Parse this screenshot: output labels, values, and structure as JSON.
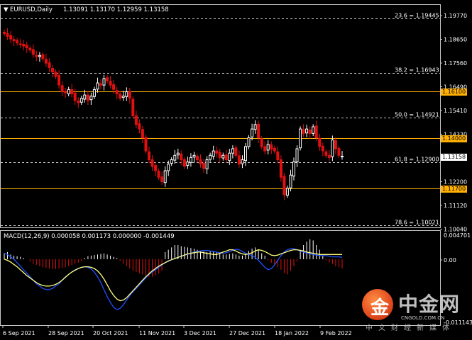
{
  "header": {
    "symbol": "EURUSD,Daily",
    "ohlc": "1.13091 1.13170 1.12959 1.13158",
    "macd_label": "MACD(12,26,9) 0.000058 0.001173 0.000000 -0.001449"
  },
  "fib_labels": [
    {
      "text": "23.6 = 1.19445",
      "price": 1.19445
    },
    {
      "text": "38.2 = 1.16943",
      "price": 1.16943
    },
    {
      "text": "50.0 = 1.14921",
      "price": 1.14921
    },
    {
      "text": "61.8 = 1.12900",
      "price": 1.129
    },
    {
      "text": "78.6 = 1.10021",
      "price": 1.10021
    }
  ],
  "level_lines": [
    {
      "label": "1.16100",
      "price": 1.161
    },
    {
      "label": "1.14000",
      "price": 1.14
    },
    {
      "label": "1.11700",
      "price": 1.117
    }
  ],
  "current_price": {
    "label": "1.13158",
    "price": 1.13158
  },
  "price_axis": [
    "1.19770",
    "1.18650",
    "1.17560",
    "1.16490",
    "1.15410",
    "1.14330",
    "1.13250",
    "1.12200",
    "1.11120",
    "1.10040"
  ],
  "macd_axis": [
    "0.004701",
    "0.00",
    "-0.011143"
  ],
  "date_axis": [
    "6 Sep 2021",
    "28 Sep 2021",
    "20 Oct 2021",
    "11 Nov 2021",
    "3 Dec 2021",
    "27 Dec 2021",
    "18 Jan 2022",
    "9 Feb 2022"
  ],
  "logo": {
    "cn": "中金网",
    "domain": "CNGOLD.COM.CN",
    "sub": "中文财经新媒体",
    "mark": "金"
  },
  "colors": {
    "up": "#ffffff",
    "down": "#e01010",
    "level": "#ffb000",
    "macd_signal": "#ffff80",
    "macd_line": "#2050ff",
    "grid": "#c8c8c8"
  },
  "chart_data": {
    "type": "candlestick",
    "price_range": [
      1.0995,
      1.2002
    ],
    "macd_range": [
      -0.011143,
      0.004701
    ],
    "closes": [
      1.1875,
      1.1862,
      1.185,
      1.1842,
      1.1832,
      1.1826,
      1.1818,
      1.181,
      1.18,
      1.178,
      1.177,
      1.1775,
      1.176,
      1.174,
      1.172,
      1.17,
      1.168,
      1.164,
      1.161,
      1.1605,
      1.162,
      1.16,
      1.157,
      1.156,
      1.158,
      1.1595,
      1.157,
      1.159,
      1.162,
      1.165,
      1.164,
      1.167,
      1.166,
      1.164,
      1.162,
      1.16,
      1.158,
      1.159,
      1.161,
      1.158,
      1.15,
      1.146,
      1.144,
      1.14,
      1.134,
      1.13,
      1.127,
      1.125,
      1.122,
      1.12,
      1.125,
      1.128,
      1.13,
      1.132,
      1.133,
      1.13,
      1.127,
      1.129,
      1.131,
      1.132,
      1.13,
      1.128,
      1.126,
      1.13,
      1.132,
      1.134,
      1.133,
      1.131,
      1.132,
      1.13,
      1.133,
      1.135,
      1.132,
      1.128,
      1.13,
      1.136,
      1.14,
      1.144,
      1.146,
      1.14,
      1.136,
      1.134,
      1.137,
      1.135,
      1.134,
      1.13,
      1.122,
      1.114,
      1.117,
      1.123,
      1.129,
      1.135,
      1.144,
      1.142,
      1.144,
      1.142,
      1.145,
      1.14,
      1.136,
      1.134,
      1.132,
      1.131,
      1.139,
      1.135,
      1.132,
      1.1316
    ],
    "macd_hist": [
      0.001,
      0.0012,
      0.0008,
      0.0006,
      0.0005,
      0.0004,
      0.0002,
      0.0,
      -0.0004,
      -0.0008,
      -0.001,
      -0.0012,
      -0.0014,
      -0.0015,
      -0.0016,
      -0.0017,
      -0.0017,
      -0.0016,
      -0.0015,
      -0.0014,
      -0.0012,
      -0.001,
      -0.0008,
      -0.0006,
      -0.0004,
      0.0002,
      0.0005,
      0.0006,
      0.0007,
      0.0008,
      0.0009,
      0.001,
      0.0008,
      0.0006,
      0.0004,
      0.0002,
      -0.0003,
      -0.0008,
      -0.0012,
      -0.0016,
      -0.002,
      -0.0022,
      -0.0024,
      -0.0026,
      -0.0028,
      -0.003,
      -0.003,
      -0.0028,
      -0.0025,
      -0.002,
      0.0012,
      0.0016,
      0.002,
      0.0024,
      0.0024,
      0.0022,
      0.0021,
      0.002,
      0.0019,
      0.0018,
      0.0016,
      0.0014,
      0.0013,
      0.0012,
      0.0013,
      0.0014,
      0.0012,
      0.001,
      0.0008,
      0.0008,
      0.0009,
      0.001,
      0.0008,
      0.0006,
      0.0006,
      0.001,
      0.0014,
      0.0018,
      0.002,
      0.0016,
      0.001,
      0.0006,
      -0.0002,
      -0.0006,
      -0.001,
      -0.0014,
      -0.0018,
      -0.0024,
      -0.0026,
      -0.002,
      -0.0012,
      -0.0004,
      0.0016,
      0.0024,
      0.003,
      0.0034,
      0.0032,
      0.0024,
      0.0016,
      0.0006,
      -0.0002,
      -0.0006,
      -0.0008,
      -0.0012,
      -0.0014,
      -0.0016
    ],
    "macd_signal": [
      0.0,
      -0.0002,
      -0.0005,
      -0.0009,
      -0.0013,
      -0.0018,
      -0.0023,
      -0.0028,
      -0.0032,
      -0.0036,
      -0.004,
      -0.0043,
      -0.0045,
      -0.0046,
      -0.0046,
      -0.0045,
      -0.0043,
      -0.004,
      -0.0036,
      -0.0031,
      -0.0026,
      -0.0022,
      -0.0019,
      -0.0016,
      -0.0014,
      -0.0013,
      -0.0013,
      -0.0014,
      -0.0016,
      -0.002,
      -0.0026,
      -0.0034,
      -0.0044,
      -0.0054,
      -0.0062,
      -0.0068,
      -0.0071,
      -0.007,
      -0.0066,
      -0.006,
      -0.0054,
      -0.0048,
      -0.0042,
      -0.0036,
      -0.003,
      -0.0025,
      -0.002,
      -0.0016,
      -0.0012,
      -0.0009,
      -0.0006,
      -0.0003,
      -0.0001,
      0.0001,
      0.0003,
      0.0005,
      0.0007,
      0.0009,
      0.001,
      0.0011,
      0.0012,
      0.0012,
      0.0011,
      0.001,
      0.0009,
      0.0008,
      0.0008,
      0.001,
      0.0012,
      0.0014,
      0.0016,
      0.0016,
      0.0014,
      0.0011,
      0.0009,
      0.0008,
      0.0009,
      0.0011,
      0.0014,
      0.0016,
      0.0015,
      0.0013,
      0.001,
      0.0007,
      0.0006,
      0.0007,
      0.0009,
      0.0011,
      0.0013,
      0.0015,
      0.0016,
      0.0016,
      0.0015,
      0.0014,
      0.0012,
      0.0011,
      0.001,
      0.0009,
      0.0008,
      0.0008,
      0.0008,
      0.0008,
      0.0008,
      0.0008,
      0.0008,
      0.0008
    ],
    "macd_main": [
      0.001,
      0.0008,
      0.0004,
      0.0,
      -0.0006,
      -0.0012,
      -0.0018,
      -0.0024,
      -0.003,
      -0.0036,
      -0.0042,
      -0.0046,
      -0.005,
      -0.0052,
      -0.0052,
      -0.005,
      -0.0046,
      -0.0042,
      -0.0036,
      -0.003,
      -0.0026,
      -0.0022,
      -0.0018,
      -0.0016,
      -0.0014,
      -0.0013,
      -0.0014,
      -0.0017,
      -0.0022,
      -0.003,
      -0.004,
      -0.0052,
      -0.0064,
      -0.0074,
      -0.0082,
      -0.0086,
      -0.0084,
      -0.0078,
      -0.007,
      -0.0062,
      -0.0056,
      -0.005,
      -0.0044,
      -0.0038,
      -0.0032,
      -0.0026,
      -0.0022,
      -0.0018,
      -0.0014,
      -0.001,
      -0.0006,
      -0.0004,
      -0.0001,
      0.0001,
      0.0003,
      0.0005,
      0.0007,
      0.0008,
      0.001,
      0.0012,
      0.0013,
      0.0014,
      0.0015,
      0.0015,
      0.0014,
      0.0013,
      0.0012,
      0.0011,
      0.001,
      0.0011,
      0.0013,
      0.0015,
      0.0017,
      0.0016,
      0.0013,
      0.001,
      0.0008,
      0.0006,
      0.0003,
      -0.0002,
      -0.0008,
      -0.0014,
      -0.0018,
      -0.0016,
      -0.001,
      -0.0002,
      0.0006,
      0.0012,
      0.0016,
      0.0018,
      0.0018,
      0.0016,
      0.0014,
      0.0012,
      0.001,
      0.0009,
      0.0008,
      0.0007,
      0.0006,
      0.0006,
      0.0006,
      0.0005,
      0.0004,
      0.0004,
      0.0004,
      0.0003
    ]
  }
}
